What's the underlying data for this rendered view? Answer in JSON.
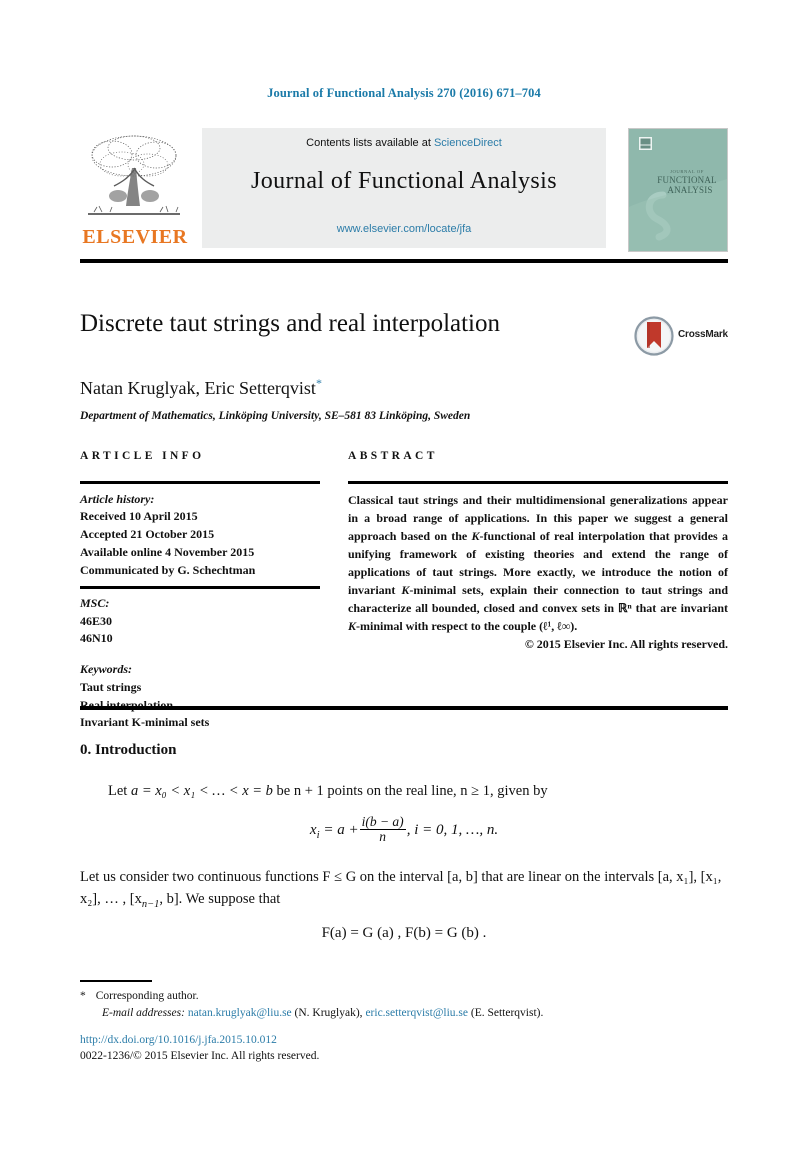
{
  "running_head": "Journal of Functional Analysis 270 (2016) 671–704",
  "masthead": {
    "publisher_name": "ELSEVIER",
    "contents_prefix": "Contents lists available at ",
    "sciencedirect_link": "ScienceDirect",
    "journal_title": "Journal of Functional Analysis",
    "journal_url": "www.elsevier.com/locate/jfa",
    "cover": {
      "line1": "JOURNAL OF",
      "line2": "FUNCTIONAL",
      "line3": "ANALYSIS",
      "bg_color": "#8fb8ac"
    },
    "link_color": "#2b7ca8",
    "banner_bg": "#eceded",
    "elsevier_orange": "#E87722"
  },
  "title_block": {
    "title": "Discrete taut strings and real interpolation",
    "authors": "Natan Kruglyak, Eric Setterqvist",
    "author_star": "*",
    "affiliation": "Department of Mathematics, Linköping University, SE–581 83 Linköping, Sweden",
    "crossmark_label": "CrossMark"
  },
  "article_info": {
    "heading": "ARTICLE INFO",
    "history_label": "Article history:",
    "history": [
      "Received 10 April 2015",
      "Accepted 21 October 2015",
      "Available online 4 November 2015",
      "Communicated by G. Schechtman"
    ],
    "msc_label": "MSC:",
    "msc": [
      "46E30",
      "46N10"
    ],
    "keywords_label": "Keywords:",
    "keywords": [
      "Taut strings",
      "Real interpolation",
      "Invariant K-minimal sets"
    ]
  },
  "abstract": {
    "heading": "ABSTRACT",
    "part1": "Classical taut strings and their multidimensional generalizations appear in a broad range of applications. In this paper we suggest a general approach based on the ",
    "kfunc": "K",
    "part2": "-functional of real interpolation that provides a unifying framework of existing theories and extend the range of applications of taut strings. More exactly, we introduce the notion of invariant ",
    "kmin1": "K",
    "part3": "-minimal sets, explain their connection to taut strings and characterize all bounded, closed and convex sets in ",
    "rn": "ℝⁿ",
    "part4": " that are invariant ",
    "kmin2": "K",
    "part5": "-minimal with respect to the couple (ℓ¹, ℓ∞).",
    "copyright": "© 2015 Elsevier Inc. All rights reserved."
  },
  "body": {
    "section_number_title": "0. Introduction",
    "paragraph_1": {
      "lead": "Let ",
      "a": "a",
      "eq": " = x₀ < x₁ < … < x",
      "sub_n": "n",
      "eq2": " = b",
      "mid": " be n + 1 points on the real line, n ≥ 1, given by"
    },
    "equation_1": {
      "lhs": "x",
      "lhs_sub": "i",
      "eq": " = a +",
      "num": "i(b − a)",
      "den": "n",
      "tail": ", i = 0, 1, …, n."
    },
    "paragraph_2": {
      "line1": "Let us consider two continuous functions F ≤ G on the interval [a, b] that are linear on",
      "line2": "the intervals [a, x₁], [x₁, x₂], … , [x",
      "line2_sub": "n−1",
      "line2_tail": ", b]. We suppose that"
    },
    "equation_2": "F(a) = G (a) , F(b) = G (b) ."
  },
  "footnotes": {
    "star": "*",
    "corresponding": "Corresponding author.",
    "email_label": "E-mail addresses:",
    "email1": "natan.kruglyak@liu.se",
    "email1_attr": "(N. Kruglyak),",
    "email2": "eric.setterqvist@liu.se",
    "email2_attr": "(E. Setterqvist)."
  },
  "imprint": {
    "doi": "http://dx.doi.org/10.1016/j.jfa.2015.10.012",
    "issn_line": "0022-1236/© 2015 Elsevier Inc. All rights reserved."
  }
}
